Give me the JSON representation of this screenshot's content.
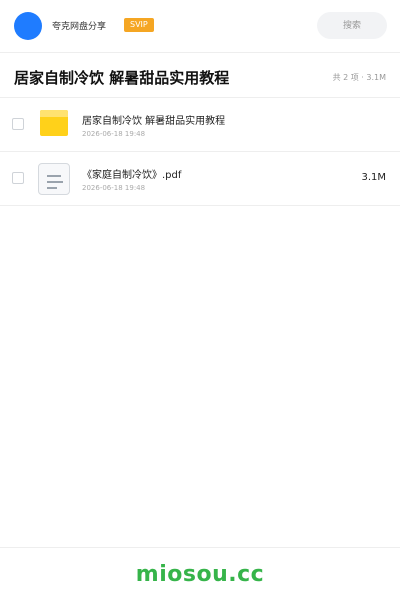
{
  "header": {
    "app_name": "夸克网盘分享",
    "badge": "SVIP",
    "search_placeholder": "搜索"
  },
  "share": {
    "title": "居家自制冷饮 解暑甜品实用教程",
    "summary": "共 2 项 · 3.1M"
  },
  "files": [
    {
      "name": "居家自制冷饮 解暑甜品实用教程",
      "date": "2026-06-18 19:48",
      "size": "",
      "icon": "folder-icon"
    },
    {
      "name": "《家庭自制冷饮》.pdf",
      "date": "2026-06-18 19:48",
      "size": "3.1M",
      "icon": "document-icon"
    }
  ],
  "footer": {
    "watermark": "miosou.cc"
  },
  "colors": {
    "avatar": "#1f7cff",
    "badge": "#f5a623",
    "folder": "#ffd11a",
    "watermark": "#36b44a"
  }
}
